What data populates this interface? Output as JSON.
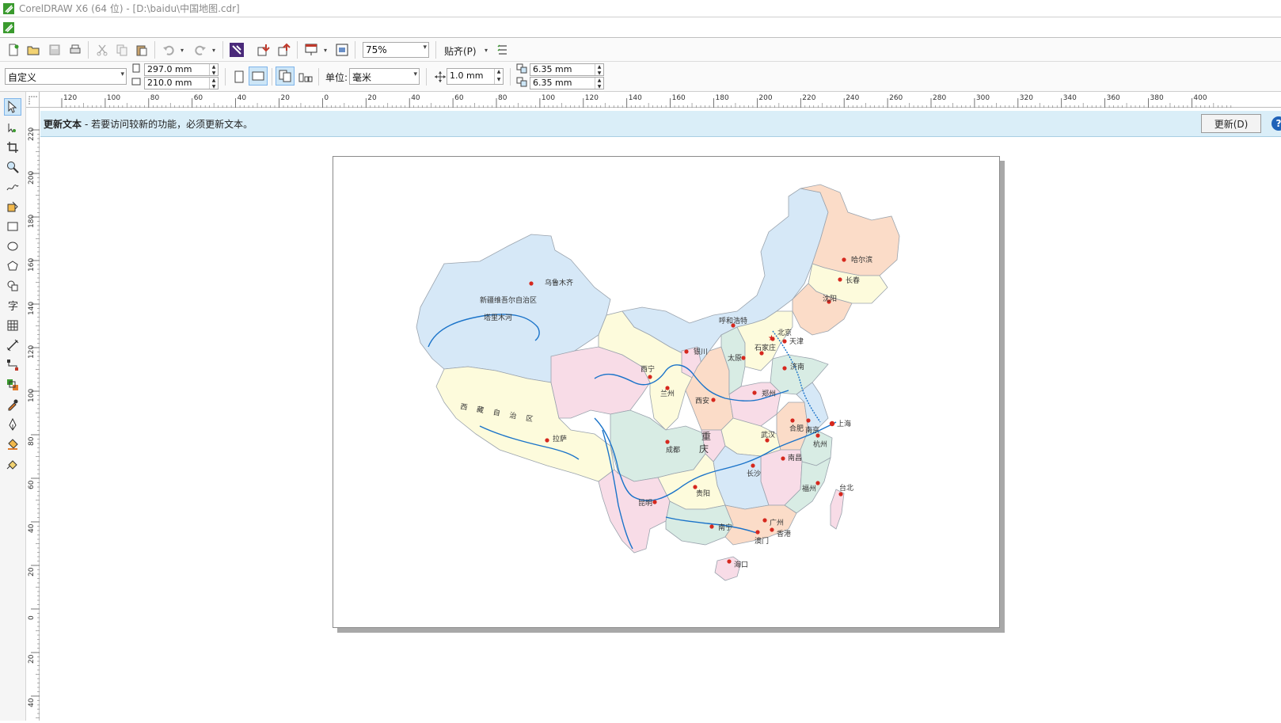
{
  "window": {
    "title": "CorelDRAW X6 (64 位) - [D:\\baidu\\中国地图.cdr]"
  },
  "toolbar1": {
    "zoom_value": "75%",
    "snap_label": "贴齐(P)"
  },
  "toolbar2": {
    "page_preset": "自定义",
    "page_width": "297.0 mm",
    "page_height": "210.0 mm",
    "units_label": "单位:",
    "units_value": "毫米",
    "nudge_value": "1.0 mm",
    "dup_x": "6.35 mm",
    "dup_y": "6.35 mm"
  },
  "ruler": {
    "h_ticks": [
      "120",
      "100",
      "80",
      "60",
      "40",
      "20",
      "0",
      "20",
      "40",
      "60",
      "80",
      "100",
      "120",
      "140",
      "160",
      "180",
      "200",
      "220",
      "240",
      "260",
      "280",
      "300",
      "320",
      "340",
      "360",
      "380",
      "400"
    ],
    "v_ticks": [
      "220",
      "200",
      "180",
      "160",
      "140",
      "120",
      "100",
      "80",
      "60",
      "40",
      "20",
      "0",
      "20",
      "40"
    ]
  },
  "notification": {
    "bold": "更新文本",
    "message": "- 若要访问较新的功能，必须更新文本。",
    "button": "更新(D)",
    "help": "?",
    "close": "✕"
  },
  "map": {
    "cities": [
      {
        "name": "乌鲁木齐"
      },
      {
        "name": "新疆维吾尔自治区"
      },
      {
        "name": "塔里木河"
      },
      {
        "name": "西藏自治区"
      },
      {
        "name": "拉萨"
      },
      {
        "name": "西宁"
      },
      {
        "name": "兰州"
      },
      {
        "name": "银川"
      },
      {
        "name": "呼和浩特"
      },
      {
        "name": "北京"
      },
      {
        "name": "天津"
      },
      {
        "name": "石家庄"
      },
      {
        "name": "太原"
      },
      {
        "name": "济南"
      },
      {
        "name": "郑州"
      },
      {
        "name": "西安"
      },
      {
        "name": "成都"
      },
      {
        "name": "重"
      },
      {
        "name": "庆"
      },
      {
        "name": "武汉"
      },
      {
        "name": "合肥"
      },
      {
        "name": "南京"
      },
      {
        "name": "上海"
      },
      {
        "name": "杭州"
      },
      {
        "name": "南昌"
      },
      {
        "name": "长沙"
      },
      {
        "name": "贵阳"
      },
      {
        "name": "昆明"
      },
      {
        "name": "福州"
      },
      {
        "name": "台北"
      },
      {
        "name": "南宁"
      },
      {
        "name": "广州"
      },
      {
        "name": "香港"
      },
      {
        "name": "澳门"
      },
      {
        "name": "海口"
      },
      {
        "name": "哈尔滨"
      },
      {
        "name": "长春"
      },
      {
        "name": "沈阳"
      }
    ]
  },
  "colors": {
    "notification_bg": "#daeef8",
    "river": "#1a73c9",
    "city_dot": "#d6281e"
  }
}
